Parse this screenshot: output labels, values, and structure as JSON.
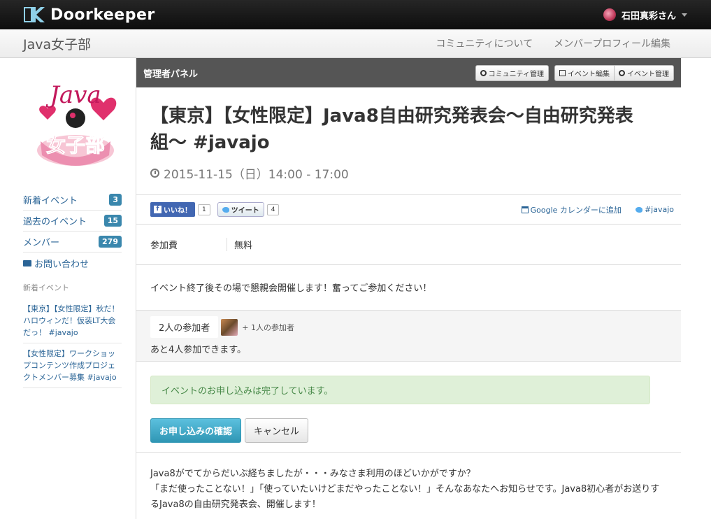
{
  "brand": {
    "name": "Doorkeeper"
  },
  "user": {
    "name": "石田真彩さん"
  },
  "community": {
    "name": "Java女子部",
    "links": [
      "コミュニティについて",
      "メンバープロフィール編集"
    ]
  },
  "sidebar": {
    "logo_text": {
      "top": "Java",
      "bottom": "女子部"
    },
    "items": [
      {
        "label": "新着イベント",
        "count": "3"
      },
      {
        "label": "過去のイベント",
        "count": "15"
      },
      {
        "label": "メンバー",
        "count": "279"
      }
    ],
    "contact": "お問い合わせ",
    "recent_heading": "新着イベント",
    "recent_events": [
      "【東京】【女性限定】秋だ！ハロウィンだ！仮装LT大会だっ！ #javajo",
      "【女性限定】ワークショップコンテンツ作成プロジェクトメンバー募集 #javajo"
    ]
  },
  "admin": {
    "title": "管理者パネル",
    "btn_community": "コミュニティ管理",
    "btn_edit": "イベント編集",
    "btn_manage": "イベント管理"
  },
  "event": {
    "title": "【東京】【女性限定】Java8自由研究発表会〜自由研究発表組〜 #javajo",
    "date": "2015-11-15（日）14:00 - 17:00",
    "fee_label": "参加費",
    "fee_value": "無料",
    "note": "イベント終了後その場で懇親会開催します！奮ってご参加ください！",
    "description": [
      "Java8がでてからだいぶ経ちましたが・・・みなさま利用のほどいかがですか？",
      "「まだ使ったことない！」「使っていたいけどまだやったことない！」そんなあなたへお知らせです。Java8初心者がお送りするJava8の自由研究発表会、開催します！"
    ]
  },
  "social": {
    "fb_label": "いいね！",
    "fb_count": "1",
    "tw_label": "ツイート",
    "tw_count": "4",
    "gcal": "Google カレンダーに追加",
    "hashtag": "#javajo"
  },
  "participants": {
    "count_label": "2人の参加者",
    "more_label": "+ 1人の参加者",
    "remaining": "あと4人参加できます。"
  },
  "apply": {
    "status": "イベントのお申し込みは完了しています。",
    "confirm_btn": "お申し込みの確認",
    "cancel_btn": "キャンセル"
  }
}
